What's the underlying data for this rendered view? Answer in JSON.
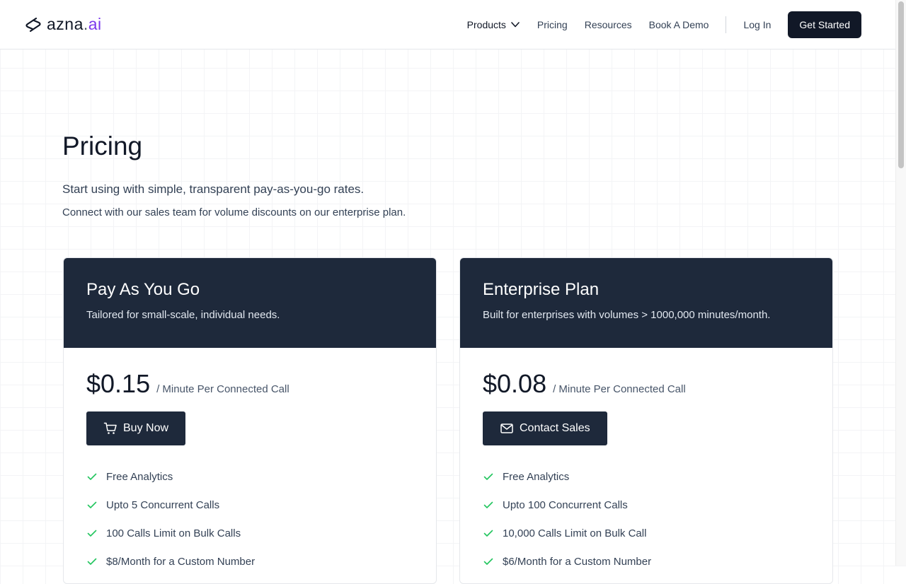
{
  "header": {
    "logo": {
      "name": "azna",
      "dot": ".",
      "tld": "ai",
      "tld_color": "#7c3aed"
    },
    "nav": {
      "products": "Products",
      "pricing": "Pricing",
      "resources": "Resources",
      "book_demo": "Book A Demo",
      "login": "Log In",
      "get_started": "Get Started"
    }
  },
  "main": {
    "title": "Pricing",
    "subtitle": "Start using with simple, transparent pay-as-you-go rates.",
    "subtitle2": "Connect with our sales team for volume discounts on our enterprise plan."
  },
  "plans": [
    {
      "name": "Pay As You Go",
      "description": "Tailored for small-scale, individual needs.",
      "price": "$0.15",
      "unit": "/ Minute Per Connected Call",
      "button": "Buy Now",
      "button_icon": "cart-icon",
      "features": [
        "Free Analytics",
        "Upto 5 Concurrent Calls",
        "100 Calls Limit on Bulk Calls",
        "$8/Month for a Custom Number"
      ]
    },
    {
      "name": "Enterprise Plan",
      "description": "Built for enterprises with volumes > 1000,000 minutes/month.",
      "price": "$0.08",
      "unit": "/ Minute Per Connected Call",
      "button": "Contact Sales",
      "button_icon": "mail-icon",
      "features": [
        "Free Analytics",
        "Upto 100 Concurrent Calls",
        "10,000 Calls Limit on Bulk Call",
        "$6/Month for a Custom Number"
      ]
    }
  ],
  "colors": {
    "header_bg": "#1e293b",
    "check_green": "#22c55e",
    "button_dark": "#111827"
  }
}
